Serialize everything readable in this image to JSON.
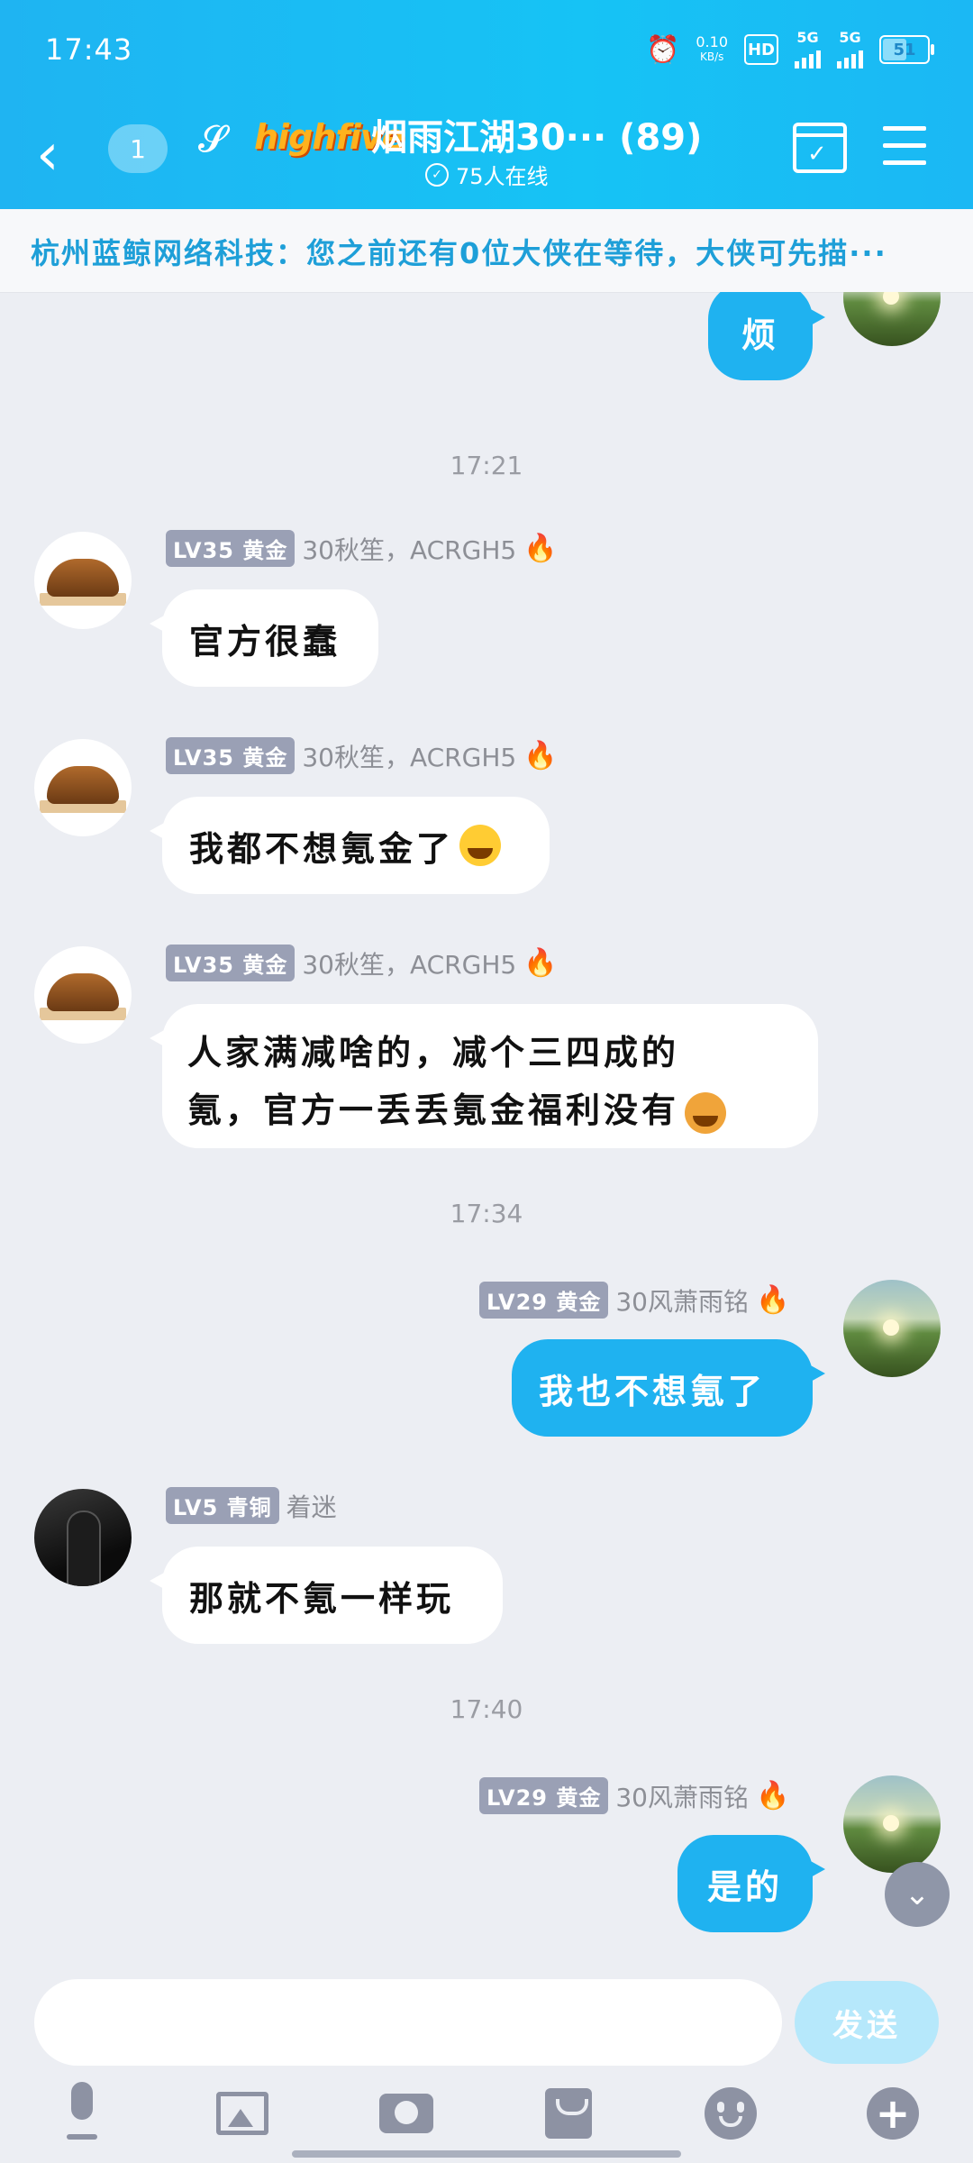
{
  "status_bar": {
    "time": "17:43",
    "speed": "0.10",
    "speed_unit": "KB/s",
    "hd_label": "HD",
    "net1": "5G",
    "net2": "5G",
    "battery": "51"
  },
  "header": {
    "back_icon": "chevron-left",
    "unread_count": "1",
    "ear_icon": "ear-icon",
    "badge_text": "highfive",
    "title": "烟雨江湖30··· (89)",
    "online_text": "75人在线",
    "calendar_icon": "calendar-check-icon",
    "menu_icon": "hamburger-icon"
  },
  "notice": {
    "text": "杭州蓝鲸网络科技：您之前还有0位大侠在等待，大侠可先描···"
  },
  "messages": [
    {
      "type": "out",
      "text": "烦"
    },
    {
      "type": "time",
      "text": "17:21"
    },
    {
      "type": "in",
      "level": "LV35 黄金",
      "nick": "30秋笙，ACRGH5",
      "text": "官方很蠢"
    },
    {
      "type": "in",
      "level": "LV35 黄金",
      "nick": "30秋笙，ACRGH5",
      "text": "我都不想氪金了"
    },
    {
      "type": "in",
      "level": "LV35 黄金",
      "nick": "30秋笙，ACRGH5",
      "line1": "人家满减啥的，减个三四成的",
      "line2": "氪，官方一丢丢氪金福利没有"
    },
    {
      "type": "time",
      "text": "17:34"
    },
    {
      "type": "out",
      "level": "LV29 黄金",
      "nick": "30风萧雨铭",
      "text": "我也不想氪了"
    },
    {
      "type": "in",
      "level": "LV5 青铜",
      "nick": "着迷",
      "text": "那就不氪一样玩"
    },
    {
      "type": "time",
      "text": "17:40"
    },
    {
      "type": "out",
      "level": "LV29 黄金",
      "nick": "30风萧雨铭",
      "text": "是的"
    }
  ],
  "input": {
    "placeholder": "",
    "send_label": "发送"
  },
  "toolbar": [
    "mic-icon",
    "image-icon",
    "camera-icon",
    "red-packet-icon",
    "emoji-icon",
    "plus-icon"
  ],
  "colors": {
    "accent": "#1fb2f0",
    "header": "#1fb4f2",
    "bg": "#eceef3"
  }
}
